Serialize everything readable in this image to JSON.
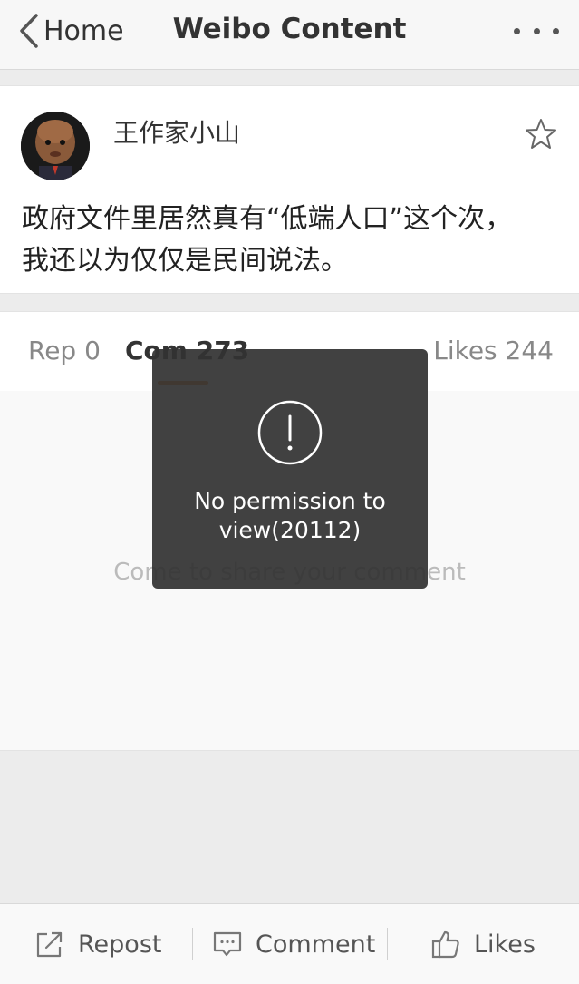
{
  "nav": {
    "back_label": "Home",
    "title": "Weibo Content",
    "more_icon": "more-dots-icon"
  },
  "post": {
    "author": "王作家小山",
    "text_line1": "政府文件里居然真有“低端人口”这个次，",
    "text_line2": "我还以为仅仅是民间说法。",
    "favorite_icon": "star-icon"
  },
  "tabs": {
    "reposts": "Rep 0",
    "comments": "Com 273",
    "likes": "Likes 244"
  },
  "comments": {
    "empty_hint": "Come to share your comment"
  },
  "toast": {
    "icon": "exclamation-circle-icon",
    "line1": "No permission to",
    "line2": "view(20112)"
  },
  "bottombar": {
    "repost": "Repost",
    "comment": "Comment",
    "likes": "Likes"
  },
  "colors": {
    "accent": "#e67e22",
    "toast_bg": "#333333"
  }
}
